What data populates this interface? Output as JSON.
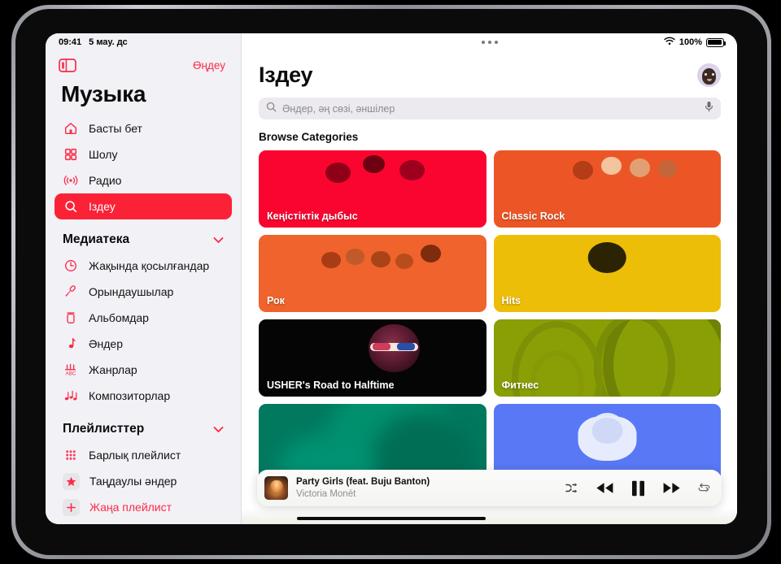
{
  "status_bar": {
    "time": "09:41",
    "date": "5 мау. дс",
    "battery_percent": "100%",
    "wifi_icon": "wifi-icon",
    "battery_icon": "battery-icon",
    "multitask_icon": "multitasking-dots-icon"
  },
  "sidebar": {
    "toggle_icon": "sidebar-toggle-icon",
    "edit_label": "Өңдеу",
    "app_title": "Музыка",
    "primary_items": [
      {
        "label": "Басты бет",
        "icon": "house-icon",
        "active": false
      },
      {
        "label": "Шолу",
        "icon": "grid-squares-icon",
        "active": false
      },
      {
        "label": "Радио",
        "icon": "radio-waves-icon",
        "active": false
      },
      {
        "label": "Іздеу",
        "icon": "search-icon",
        "active": true
      }
    ],
    "library": {
      "title": "Медиатека",
      "chevron_icon": "chevron-down-icon",
      "items": [
        {
          "label": "Жақында қосылғандар",
          "icon": "clock-icon"
        },
        {
          "label": "Орындаушылар",
          "icon": "microphone-icon"
        },
        {
          "label": "Альбомдар",
          "icon": "album-icon"
        },
        {
          "label": "Әндер",
          "icon": "music-note-icon"
        },
        {
          "label": "Жанрлар",
          "icon": "genres-icon"
        },
        {
          "label": "Композиторлар",
          "icon": "double-note-icon"
        }
      ]
    },
    "playlists": {
      "title": "Плейлисттер",
      "chevron_icon": "chevron-down-icon",
      "items": [
        {
          "label": "Барлық плейлист",
          "icon": "playlist-grid-icon",
          "accent": false
        },
        {
          "label": "Таңдаулы әндер",
          "icon": "star-icon",
          "accent": false
        },
        {
          "label": "Жаңа плейлист",
          "icon": "plus-icon",
          "accent": true
        }
      ]
    }
  },
  "main": {
    "page_title": "Іздеу",
    "avatar_icon": "memoji-avatar",
    "search": {
      "placeholder": "Әндер, әң сөзі, әншілер",
      "value": "",
      "search_icon": "search-icon",
      "mic_icon": "microphone-icon"
    },
    "browse_label": "Browse Categories",
    "categories": [
      {
        "label": "Кеңістіктік дыбыс",
        "color": "#fa0530",
        "art": "group-rap"
      },
      {
        "label": "Classic Rock",
        "color": "#ec5626",
        "art": "group-classic"
      },
      {
        "label": "Рок",
        "color": "#f0632c",
        "art": "group-rock"
      },
      {
        "label": "Hits",
        "color": "#edbe08",
        "art": "solo-drake"
      },
      {
        "label": "USHER's Road to Halftime",
        "color": "#050505",
        "art": "solo-usher"
      },
      {
        "label": "Фитнес",
        "color": "#8a9e06",
        "art": "weights"
      },
      {
        "label": "",
        "color": "#00795f",
        "art": "teal-gradient"
      },
      {
        "label": "",
        "color": "#5878f5",
        "art": "solo-blue"
      }
    ]
  },
  "now_playing": {
    "artwork_icon": "album-artwork",
    "title": "Party Girls (feat. Buju Banton)",
    "artist": "Victoria Monét",
    "controls": [
      {
        "name": "shuffle-button",
        "icon": "shuffle-icon"
      },
      {
        "name": "previous-button",
        "icon": "rewind-icon"
      },
      {
        "name": "pause-button",
        "icon": "pause-icon"
      },
      {
        "name": "next-button",
        "icon": "fast-forward-icon"
      },
      {
        "name": "repeat-button",
        "icon": "repeat-icon"
      }
    ]
  },
  "home_indicator": "home-indicator"
}
